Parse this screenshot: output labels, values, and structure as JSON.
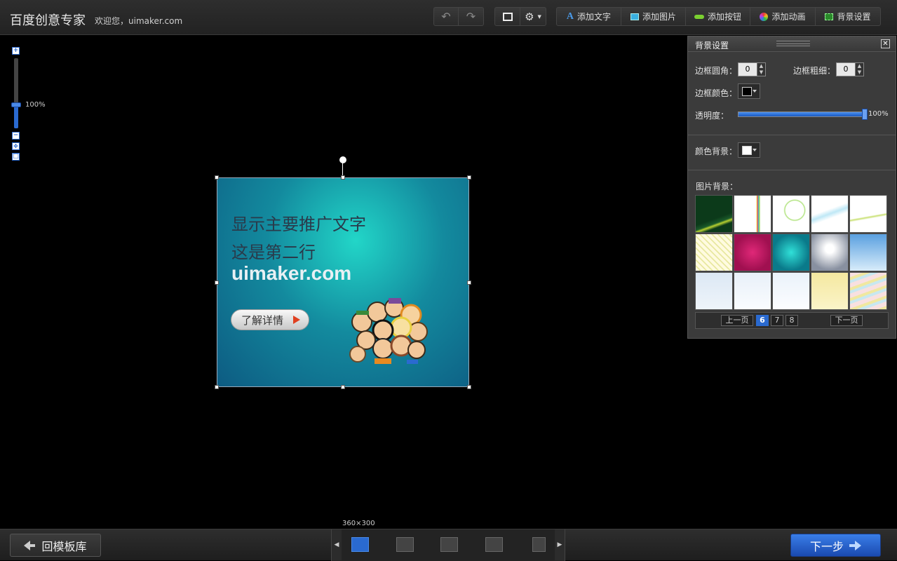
{
  "header": {
    "app_title": "百度创意专家",
    "welcome": "欢迎您，uimaker.com"
  },
  "toolbar": {
    "add_text": "添加文字",
    "add_image": "添加图片",
    "add_button": "添加按钮",
    "add_animation": "添加动画",
    "background_settings": "背景设置"
  },
  "zoom": {
    "level_label": "100%",
    "level": 1.0
  },
  "canvas": {
    "dimensions_label": "360×300",
    "promo_line_1": "显示主要推广文字",
    "promo_line_2": "这是第二行",
    "promo_line_3": "uimaker.com",
    "cta_label": "了解详情"
  },
  "panel": {
    "title": "背景设置",
    "close": "✕",
    "border_radius_label": "边框圆角：",
    "border_radius_value": "0",
    "border_width_label": "边框粗细：",
    "border_width_value": "0",
    "border_color_label": "边框颜色：",
    "border_color": "#000000",
    "opacity_label": "透明度：",
    "opacity_value": "100%",
    "opacity": 1.0,
    "color_bg_label": "颜色背景：",
    "color_bg": "#ffffff",
    "image_bg_label": "图片背景：",
    "thumbnails": [
      "#0c3a1a",
      "#ffffff",
      "#ffffff",
      "#eaf6fb",
      "#ffffff",
      "#f4f0d8",
      "#b01a5a",
      "#12a8a8",
      "#6a7080",
      "#7ab8ec",
      "#dce8f4",
      "#e8f0f8",
      "#eaf2fa",
      "#f4e8a0",
      "#f4ecec"
    ],
    "pager": {
      "prev": "上一页",
      "pages": [
        "6",
        "7",
        "8"
      ],
      "active_page": "6",
      "next": "下一页"
    }
  },
  "bottom": {
    "back_label": "回模板库",
    "next_label": "下一步",
    "page_count": 5,
    "active_page_index": 0
  },
  "colors": {
    "accent": "#2a6ad0"
  }
}
